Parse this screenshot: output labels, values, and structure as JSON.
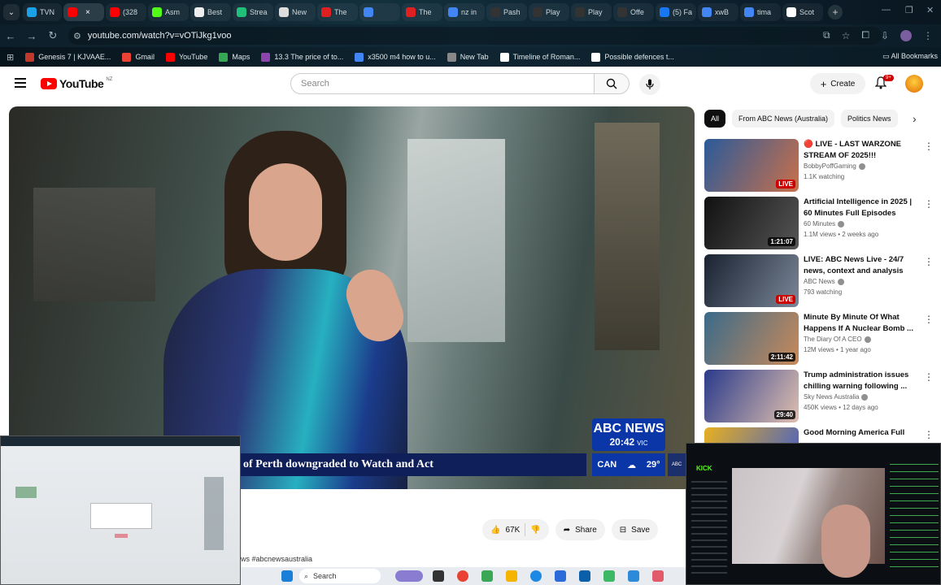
{
  "browser": {
    "tabs": [
      {
        "label": "TVN",
        "color": "#1aa1e8"
      },
      {
        "label": "",
        "color": "#ff0000",
        "active": true
      },
      {
        "label": "(328",
        "color": "#ff0000"
      },
      {
        "label": "Asm",
        "color": "#53fc18"
      },
      {
        "label": "Best",
        "color": "#eeeeee"
      },
      {
        "label": "Strea",
        "color": "#20c07a"
      },
      {
        "label": "New",
        "color": "#dddddd"
      },
      {
        "label": "The",
        "color": "#e02020"
      },
      {
        "label": "",
        "color": "#4285f4"
      },
      {
        "label": "The",
        "color": "#e02020"
      },
      {
        "label": "nz in",
        "color": "#4285f4"
      },
      {
        "label": "Pash",
        "color": "#333333"
      },
      {
        "label": "Play",
        "color": "#333333"
      },
      {
        "label": "Play",
        "color": "#333333"
      },
      {
        "label": "Offe",
        "color": "#333333"
      },
      {
        "label": "(5) Fa",
        "color": "#1877f2"
      },
      {
        "label": "xwB",
        "color": "#4285f4"
      },
      {
        "label": "tima",
        "color": "#4285f4"
      },
      {
        "label": "Scot",
        "color": "#ffffff"
      }
    ],
    "url": "youtube.com/watch?v=vOTiJkg1voo",
    "bookmarks": [
      {
        "label": "Genesis 7 | KJVAAE...",
        "color": "#c0392b"
      },
      {
        "label": "Gmail",
        "color": "#ea4335"
      },
      {
        "label": "YouTube",
        "color": "#ff0000"
      },
      {
        "label": "Maps",
        "color": "#34a853"
      },
      {
        "label": "13.3 The price of to...",
        "color": "#8e44ad"
      },
      {
        "label": "x3500 m4 how to u...",
        "color": "#4285f4"
      },
      {
        "label": "New Tab",
        "color": "#888888"
      },
      {
        "label": "Timeline of Roman...",
        "color": "#ffffff"
      },
      {
        "label": "Possible defences t...",
        "color": "#ffffff"
      }
    ],
    "all_bookmarks": "All Bookmarks"
  },
  "youtube": {
    "logo": "YouTube",
    "country": "NZ",
    "search_placeholder": "Search",
    "create_label": "Create",
    "notif_count": "9+",
    "chips": [
      "All",
      "From ABC News (Australia)",
      "Politics News"
    ],
    "player": {
      "ticker": "of Perth downgraded to Watch and Act",
      "abc_title": "ABC NEWS",
      "time": "20:42",
      "state": "VIC",
      "wx_city": "CAN",
      "wx_temp": "29°"
    },
    "actions": {
      "likes": "67K",
      "share": "Share",
      "save": "Save"
    },
    "desc": "ws #abcnewsaustralia",
    "recommended": [
      {
        "title": "🔴 LIVE - LAST WARZONE STREAM OF 2025!!!",
        "channel": "BobbyPoffGaming",
        "meta": "1.1K watching",
        "badge": "LIVE",
        "live": true,
        "c1": "#2a5a9a",
        "c2": "#c9704a"
      },
      {
        "title": "Artificial Intelligence in 2025 | 60 Minutes Full Episodes",
        "channel": "60 Minutes",
        "meta": "1.1M views • 2 weeks ago",
        "badge": "1:21:07",
        "live": false,
        "c1": "#111111",
        "c2": "#555555"
      },
      {
        "title": "LIVE: ABC News Live - 24/7 news, context and analysis",
        "channel": "ABC News",
        "meta": "793 watching",
        "badge": "LIVE",
        "live": true,
        "c1": "#1a2230",
        "c2": "#7a8698"
      },
      {
        "title": "Minute By Minute Of What Happens If A Nuclear Bomb ...",
        "channel": "The Diary Of A CEO",
        "meta": "12M views • 1 year ago",
        "badge": "2:11:42",
        "live": false,
        "c1": "#3a6a8a",
        "c2": "#c98a5a"
      },
      {
        "title": "Trump administration issues chilling warning following ...",
        "channel": "Sky News Australia",
        "meta": "450K views • 12 days ago",
        "badge": "29:40",
        "live": false,
        "c1": "#2a3a8a",
        "c2": "#e0c0b0"
      },
      {
        "title": "Good Morning America Full",
        "channel": "",
        "meta": "",
        "badge": "",
        "live": false,
        "c1": "#e8b020",
        "c2": "#3a5ad0"
      }
    ]
  },
  "taskbar": {
    "search": "Search"
  }
}
